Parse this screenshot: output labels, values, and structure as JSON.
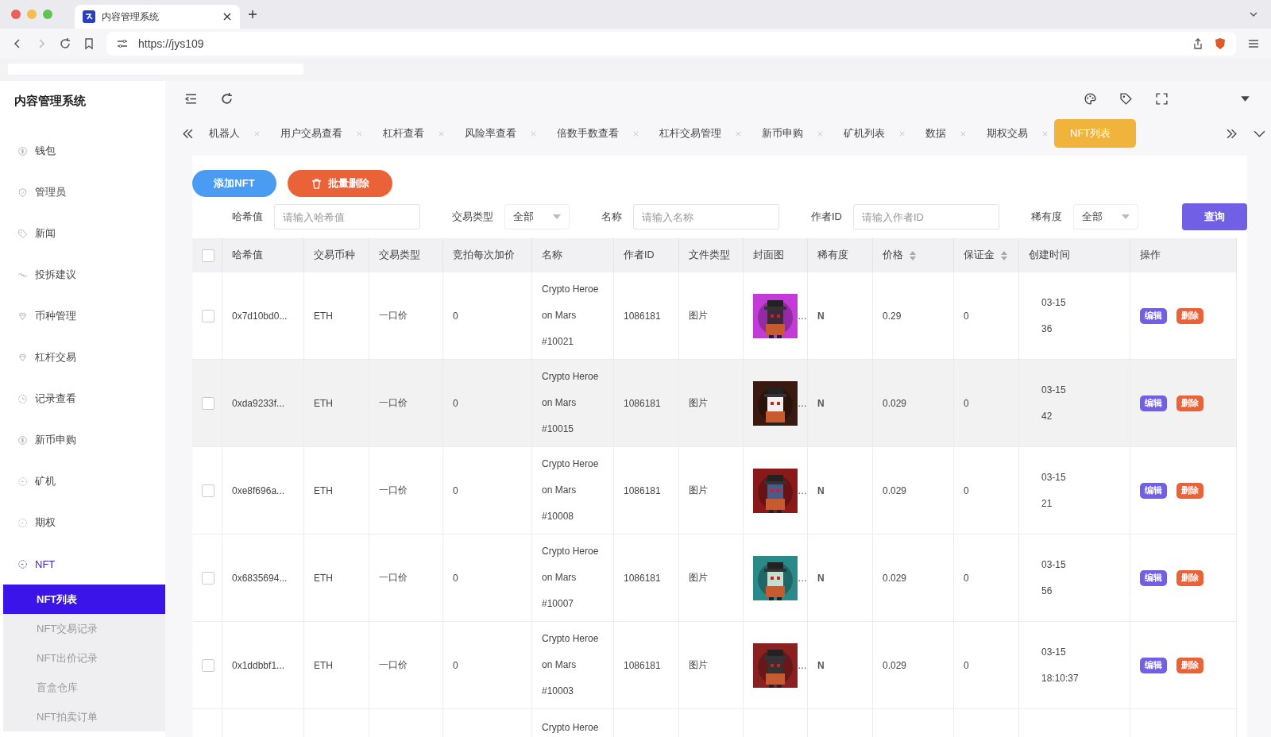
{
  "browser": {
    "tab_title": "内容管理系统",
    "url": "https://jys109"
  },
  "app": {
    "title": "内容管理系统"
  },
  "sidebar": {
    "items": [
      {
        "label": "钱包",
        "selected": false
      },
      {
        "label": "管理员",
        "selected": false
      },
      {
        "label": "新闻",
        "selected": false
      },
      {
        "label": "投拆建议",
        "selected": false
      },
      {
        "label": "币种管理",
        "selected": false
      },
      {
        "label": "杠杆交易",
        "selected": false
      },
      {
        "label": "记录查看",
        "selected": false
      },
      {
        "label": "新币申购",
        "selected": false
      },
      {
        "label": "矿机",
        "selected": false
      },
      {
        "label": "期权",
        "selected": false
      },
      {
        "label": "NFT",
        "selected": true,
        "expanded": true,
        "children": [
          {
            "label": "NFT列表",
            "selected": true
          },
          {
            "label": "NFT交易记录",
            "selected": false
          },
          {
            "label": "NFT出价记录",
            "selected": false
          },
          {
            "label": "盲盒仓库",
            "selected": false
          },
          {
            "label": "NFT拍卖订单",
            "selected": false
          }
        ]
      }
    ]
  },
  "tabs": [
    {
      "label": "机器人",
      "selected": false
    },
    {
      "label": "用户交易查看",
      "selected": false
    },
    {
      "label": "杠杆查看",
      "selected": false
    },
    {
      "label": "风险率查看",
      "selected": false
    },
    {
      "label": "倍数手数查看",
      "selected": false
    },
    {
      "label": "杠杆交易管理",
      "selected": false
    },
    {
      "label": "新币申购",
      "selected": false
    },
    {
      "label": "矿机列表",
      "selected": false
    },
    {
      "label": "数据",
      "selected": false
    },
    {
      "label": "期权交易",
      "selected": false
    },
    {
      "label": "NFT列表",
      "selected": true
    }
  ],
  "actions": [
    {
      "label": "添加NFT",
      "kind": "primary"
    },
    {
      "label": "批量删除",
      "kind": "danger"
    }
  ],
  "filters": [
    {
      "label": "哈希值",
      "kind": "input",
      "placeholder": "请输入哈希值"
    },
    {
      "label": "交易类型",
      "kind": "select",
      "value": "全部"
    },
    {
      "label": "名称",
      "kind": "input",
      "placeholder": "请输入名称"
    },
    {
      "label": "作者ID",
      "kind": "input",
      "placeholder": "请输入作者ID"
    },
    {
      "label": "稀有度",
      "kind": "select",
      "value": "全部"
    }
  ],
  "query_button": "查询",
  "table": {
    "all_checked": false,
    "columns": [
      {
        "label": "哈希值",
        "sortable": false
      },
      {
        "label": "交易币种",
        "sortable": false
      },
      {
        "label": "交易类型",
        "sortable": false
      },
      {
        "label": "竞拍每次加价",
        "sortable": false
      },
      {
        "label": "名称",
        "sortable": false
      },
      {
        "label": "作者ID",
        "sortable": false
      },
      {
        "label": "文件类型",
        "sortable": false
      },
      {
        "label": "封面图",
        "sortable": false
      },
      {
        "label": "稀有度",
        "sortable": false
      },
      {
        "label": "价格",
        "sortable": true
      },
      {
        "label": "保证金",
        "sortable": true
      },
      {
        "label": "创建时间",
        "sortable": false
      },
      {
        "label": "操作",
        "sortable": false
      }
    ],
    "rows": [
      {
        "hovered": false,
        "checked": false,
        "hash": "0x7d10bd0...",
        "currency": "ETH",
        "trade_type": "一口价",
        "bid_increment": "0",
        "name_lines": [
          "Crypto Heroe",
          "on Mars",
          "#10021"
        ],
        "author_id": "1086181",
        "file_type": "图片",
        "cover_suffix": "…",
        "rarity": "N",
        "price": "0.29",
        "deposit": "0",
        "created": [
          "03-15",
          "36"
        ],
        "buttons": [
          "编辑",
          "删除"
        ]
      },
      {
        "hovered": true,
        "checked": false,
        "hash": "0xda9233f...",
        "currency": "ETH",
        "trade_type": "一口价",
        "bid_increment": "0",
        "name_lines": [
          "Crypto Heroe",
          "on Mars",
          "#10015"
        ],
        "author_id": "1086181",
        "file_type": "图片",
        "cover_suffix": "…",
        "rarity": "N",
        "price": "0.029",
        "deposit": "0",
        "created": [
          "03-15",
          "42"
        ],
        "buttons": [
          "编辑",
          "删除"
        ]
      },
      {
        "hovered": false,
        "checked": false,
        "hash": "0xe8f696a...",
        "currency": "ETH",
        "trade_type": "一口价",
        "bid_increment": "0",
        "name_lines": [
          "Crypto Heroe",
          "on Mars",
          "#10008"
        ],
        "author_id": "1086181",
        "file_type": "图片",
        "cover_suffix": "…",
        "rarity": "N",
        "price": "0.029",
        "deposit": "0",
        "created": [
          "03-15",
          "21"
        ],
        "buttons": [
          "编辑",
          "删除"
        ]
      },
      {
        "hovered": false,
        "checked": false,
        "hash": "0x6835694...",
        "currency": "ETH",
        "trade_type": "一口价",
        "bid_increment": "0",
        "name_lines": [
          "Crypto Heroe",
          "on Mars",
          "#10007"
        ],
        "author_id": "1086181",
        "file_type": "图片",
        "cover_suffix": "…",
        "rarity": "N",
        "price": "0.029",
        "deposit": "0",
        "created": [
          "03-15",
          "56"
        ],
        "buttons": [
          "编辑",
          "删除"
        ]
      },
      {
        "hovered": false,
        "checked": false,
        "hash": "0x1ddbbf1...",
        "currency": "ETH",
        "trade_type": "一口价",
        "bid_increment": "0",
        "name_lines": [
          "Crypto Heroe",
          "on Mars",
          "#10003"
        ],
        "author_id": "1086181",
        "file_type": "图片",
        "cover_suffix": "…",
        "rarity": "N",
        "price": "0.029",
        "deposit": "0",
        "created": [
          "03-15",
          "18:10:37"
        ],
        "buttons": [
          "编辑",
          "删除"
        ]
      }
    ],
    "partial_row": {
      "name_line": "Crypto Heroe"
    }
  }
}
